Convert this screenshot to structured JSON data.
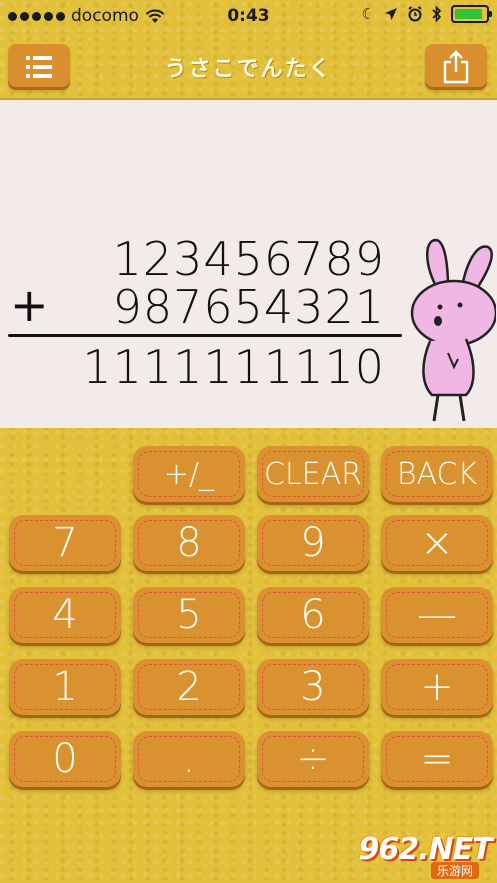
{
  "status_bar": {
    "carrier": "docomo",
    "time": "0:43",
    "battery_level": 0.9
  },
  "nav": {
    "title": "うさこでんたく",
    "menu_icon": "hamburger-menu-icon",
    "share_icon": "share-icon"
  },
  "display": {
    "operand_a": "123456789",
    "operator": "+",
    "operand_b": "987654321",
    "result": "1111111110"
  },
  "keys": [
    {
      "name": "plus-minus",
      "label": "+/_"
    },
    {
      "name": "clear",
      "label": "CLEAR"
    },
    {
      "name": "back",
      "label": "BACK"
    },
    {
      "name": "7",
      "label": "7"
    },
    {
      "name": "8",
      "label": "8"
    },
    {
      "name": "9",
      "label": "9"
    },
    {
      "name": "multiply",
      "label": "×"
    },
    {
      "name": "4",
      "label": "4"
    },
    {
      "name": "5",
      "label": "5"
    },
    {
      "name": "6",
      "label": "6"
    },
    {
      "name": "minus",
      "label": "—"
    },
    {
      "name": "1",
      "label": "1"
    },
    {
      "name": "2",
      "label": "2"
    },
    {
      "name": "3",
      "label": "3"
    },
    {
      "name": "plus",
      "label": "+"
    },
    {
      "name": "0",
      "label": "0"
    },
    {
      "name": "decimal",
      "label": "."
    },
    {
      "name": "divide",
      "label": "÷"
    },
    {
      "name": "equals",
      "label": "="
    }
  ],
  "watermark": {
    "main": "962.NET",
    "sub": "乐游网"
  },
  "colors": {
    "background": "#e2c039",
    "key": "#d9922f",
    "stitch": "#e0533a",
    "display": "#f3ebe9",
    "bunny": "#f0b6e4"
  }
}
